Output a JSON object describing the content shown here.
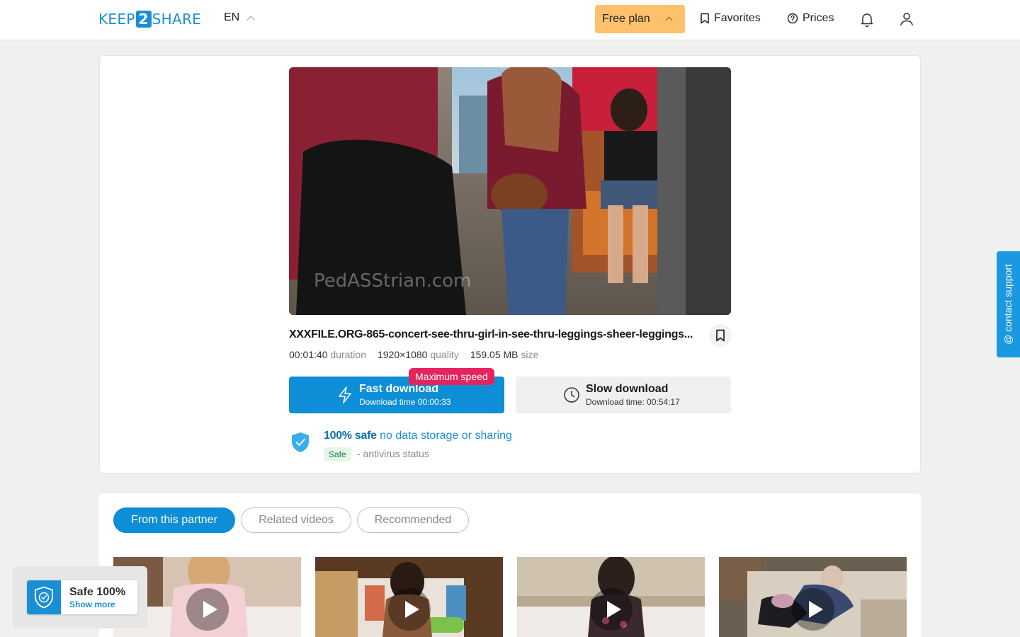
{
  "header": {
    "logo_left": "KEEP",
    "logo_mid": "2",
    "logo_right": "SHARE",
    "language": "EN",
    "free_plan": "Free plan",
    "favorites": "Favorites",
    "prices": "Prices",
    "icons": [
      "bookmark-icon",
      "help-circle-icon",
      "bell-icon",
      "user-icon"
    ]
  },
  "file": {
    "name": "XXXFILE.ORG-865-concert-see-thru-girl-in-see-thru-leggings-sheer-leggings...",
    "duration_value": "00:01:40",
    "duration_label": "duration",
    "quality_value": "1920×1080",
    "quality_label": "quality",
    "size_value": "159.05 MB",
    "size_label": "size"
  },
  "download": {
    "fast_label": "Fast download",
    "fast_time": "Download time 00:00:33",
    "max_speed_badge": "Maximum speed",
    "slow_label": "Slow download",
    "slow_time": "Download time: 00:54:17"
  },
  "safety": {
    "title_bold": "100% safe",
    "title_rest": "no data storage or sharing",
    "badge": "Safe",
    "status_text": "- antivirus status"
  },
  "support": {
    "label": "@ contact support"
  },
  "related": {
    "tabs": [
      {
        "label": "From this partner",
        "active": true
      },
      {
        "label": "Related videos",
        "active": false
      },
      {
        "label": "Recommended",
        "active": false
      }
    ]
  },
  "safe_popup": {
    "title": "Safe 100%",
    "link": "Show more"
  },
  "colors": {
    "accent": "#0d8ed6",
    "plan": "#fcc16a",
    "badge": "#e5245d",
    "safe_bg": "#e4f7ea"
  }
}
